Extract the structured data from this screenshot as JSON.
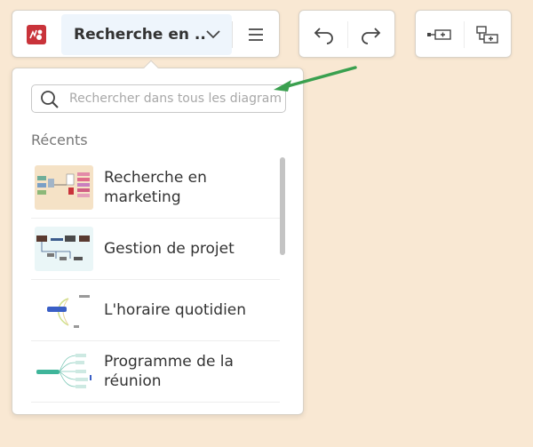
{
  "toolbar": {
    "document_title": "Recherche en ...",
    "icons": {
      "logo": "app-logo",
      "title_chevron": "chevron-down-icon",
      "menu": "hamburger-menu-icon",
      "undo": "undo-icon",
      "redo": "redo-icon",
      "insert_topic": "insert-topic-icon",
      "insert_subtopic": "insert-subtopic-icon"
    }
  },
  "panel": {
    "search": {
      "value": "",
      "placeholder": "Rechercher dans tous les diagrammes"
    },
    "recent_heading": "Récents",
    "items": [
      {
        "label": "Recherche en marketing"
      },
      {
        "label": "Gestion de projet"
      },
      {
        "label": "L'horaire quotidien"
      },
      {
        "label": "Programme de la réunion"
      }
    ]
  },
  "colors": {
    "background": "#f9e8d3",
    "logo": "#c9333a",
    "title_highlight": "#eef5fc",
    "arrow": "#3aa04f"
  }
}
